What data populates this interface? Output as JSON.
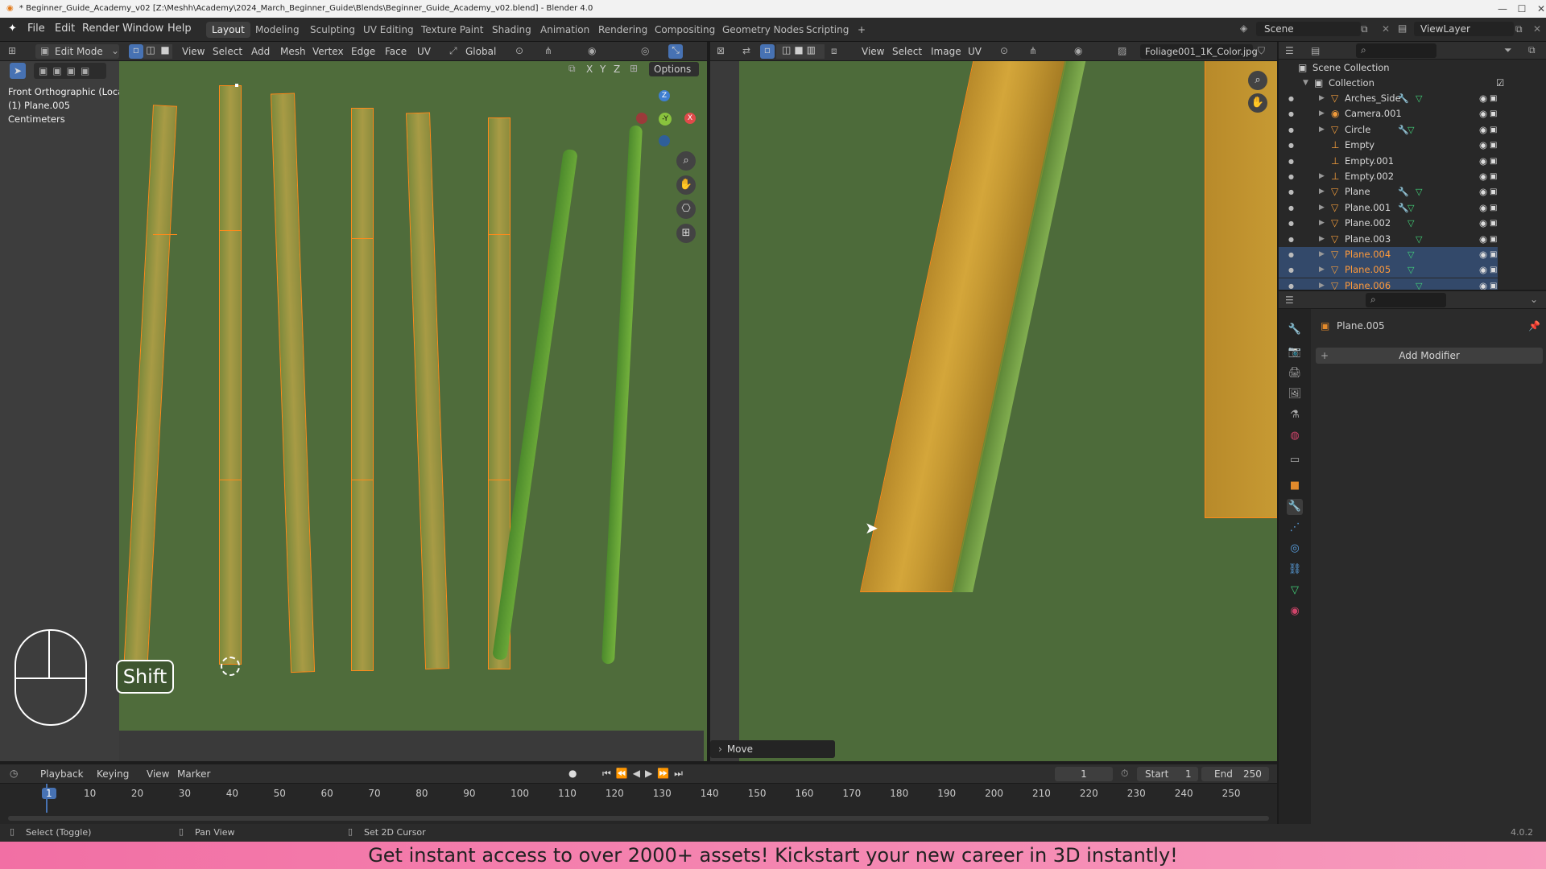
{
  "window": {
    "title": "* Beginner_Guide_Academy_v02 [Z:\\Meshh\\Academy\\2024_March_Beginner_Guide\\Blends\\Beginner_Guide_Academy_v02.blend] - Blender 4.0"
  },
  "menu": [
    "File",
    "Edit",
    "Render",
    "Window",
    "Help"
  ],
  "workspaces": [
    "Layout",
    "Modeling",
    "Sculpting",
    "UV Editing",
    "Texture Paint",
    "Shading",
    "Animation",
    "Rendering",
    "Compositing",
    "Geometry Nodes",
    "Scripting"
  ],
  "workspace_add": "+",
  "scene": {
    "label": "Scene",
    "view_layer": "ViewLayer"
  },
  "viewport3d": {
    "mode": "Edit Mode",
    "header_menus": [
      "View",
      "Select",
      "Add",
      "Mesh",
      "Vertex",
      "Edge",
      "Face",
      "UV"
    ],
    "orientation": "Global",
    "axes": [
      "X",
      "Y",
      "Z"
    ],
    "options_label": "Options",
    "overlay_lines": [
      "Front Orthographic (Local)",
      "(1) Plane.005",
      "Centimeters"
    ],
    "gizmo": {
      "z": "Z",
      "y": "-Y",
      "x": "X"
    },
    "key_hint": "Shift"
  },
  "uv_editor": {
    "menus": [
      "View",
      "Select",
      "Image",
      "UV"
    ],
    "image_name": "Foliage001_1K_Color.jpg",
    "operator_panel": "Move"
  },
  "outliner": {
    "root": "Scene Collection",
    "collection": "Collection",
    "items": [
      {
        "name": "Arches_Side",
        "icon": "mesh-icon",
        "selected": false
      },
      {
        "name": "Camera.001",
        "icon": "camera-icon",
        "selected": false
      },
      {
        "name": "Circle",
        "icon": "mesh-icon",
        "selected": false
      },
      {
        "name": "Empty",
        "icon": "empty-icon",
        "selected": false
      },
      {
        "name": "Empty.001",
        "icon": "empty-icon",
        "selected": false
      },
      {
        "name": "Empty.002",
        "icon": "image-empty-icon",
        "selected": false
      },
      {
        "name": "Plane",
        "icon": "mesh-icon",
        "selected": false
      },
      {
        "name": "Plane.001",
        "icon": "mesh-icon",
        "selected": false
      },
      {
        "name": "Plane.002",
        "icon": "mesh-icon",
        "selected": false
      },
      {
        "name": "Plane.003",
        "icon": "mesh-icon",
        "selected": false
      },
      {
        "name": "Plane.004",
        "icon": "mesh-icon",
        "selected": true
      },
      {
        "name": "Plane.005",
        "icon": "mesh-icon",
        "selected": true
      },
      {
        "name": "Plane.006",
        "icon": "mesh-icon",
        "selected": true
      }
    ]
  },
  "properties": {
    "object_name": "Plane.005",
    "add_modifier": "Add Modifier"
  },
  "timeline": {
    "menus": [
      "Playback",
      "Keying",
      "View",
      "Marker"
    ],
    "current_frame": "1",
    "start_label": "Start",
    "start": "1",
    "end_label": "End",
    "end": "250",
    "ticks": [
      "1",
      "10",
      "20",
      "30",
      "40",
      "50",
      "60",
      "70",
      "80",
      "90",
      "100",
      "110",
      "120",
      "130",
      "140",
      "150",
      "160",
      "170",
      "180",
      "190",
      "200",
      "210",
      "220",
      "230",
      "240",
      "250"
    ]
  },
  "statusbar": {
    "items": [
      "Select (Toggle)",
      "Pan View",
      "Set 2D Cursor"
    ],
    "version": "4.0.2"
  },
  "banner": {
    "text": "Get instant access to over 2000+ assets! Kickstart your new career in 3D instantly!"
  },
  "colors": {
    "accent": "#ff8a1a",
    "selection": "#33496a",
    "viewport_bg": "#4f6c3b",
    "banner_start": "#f26fa4",
    "banner_end": "#f79bbd"
  }
}
